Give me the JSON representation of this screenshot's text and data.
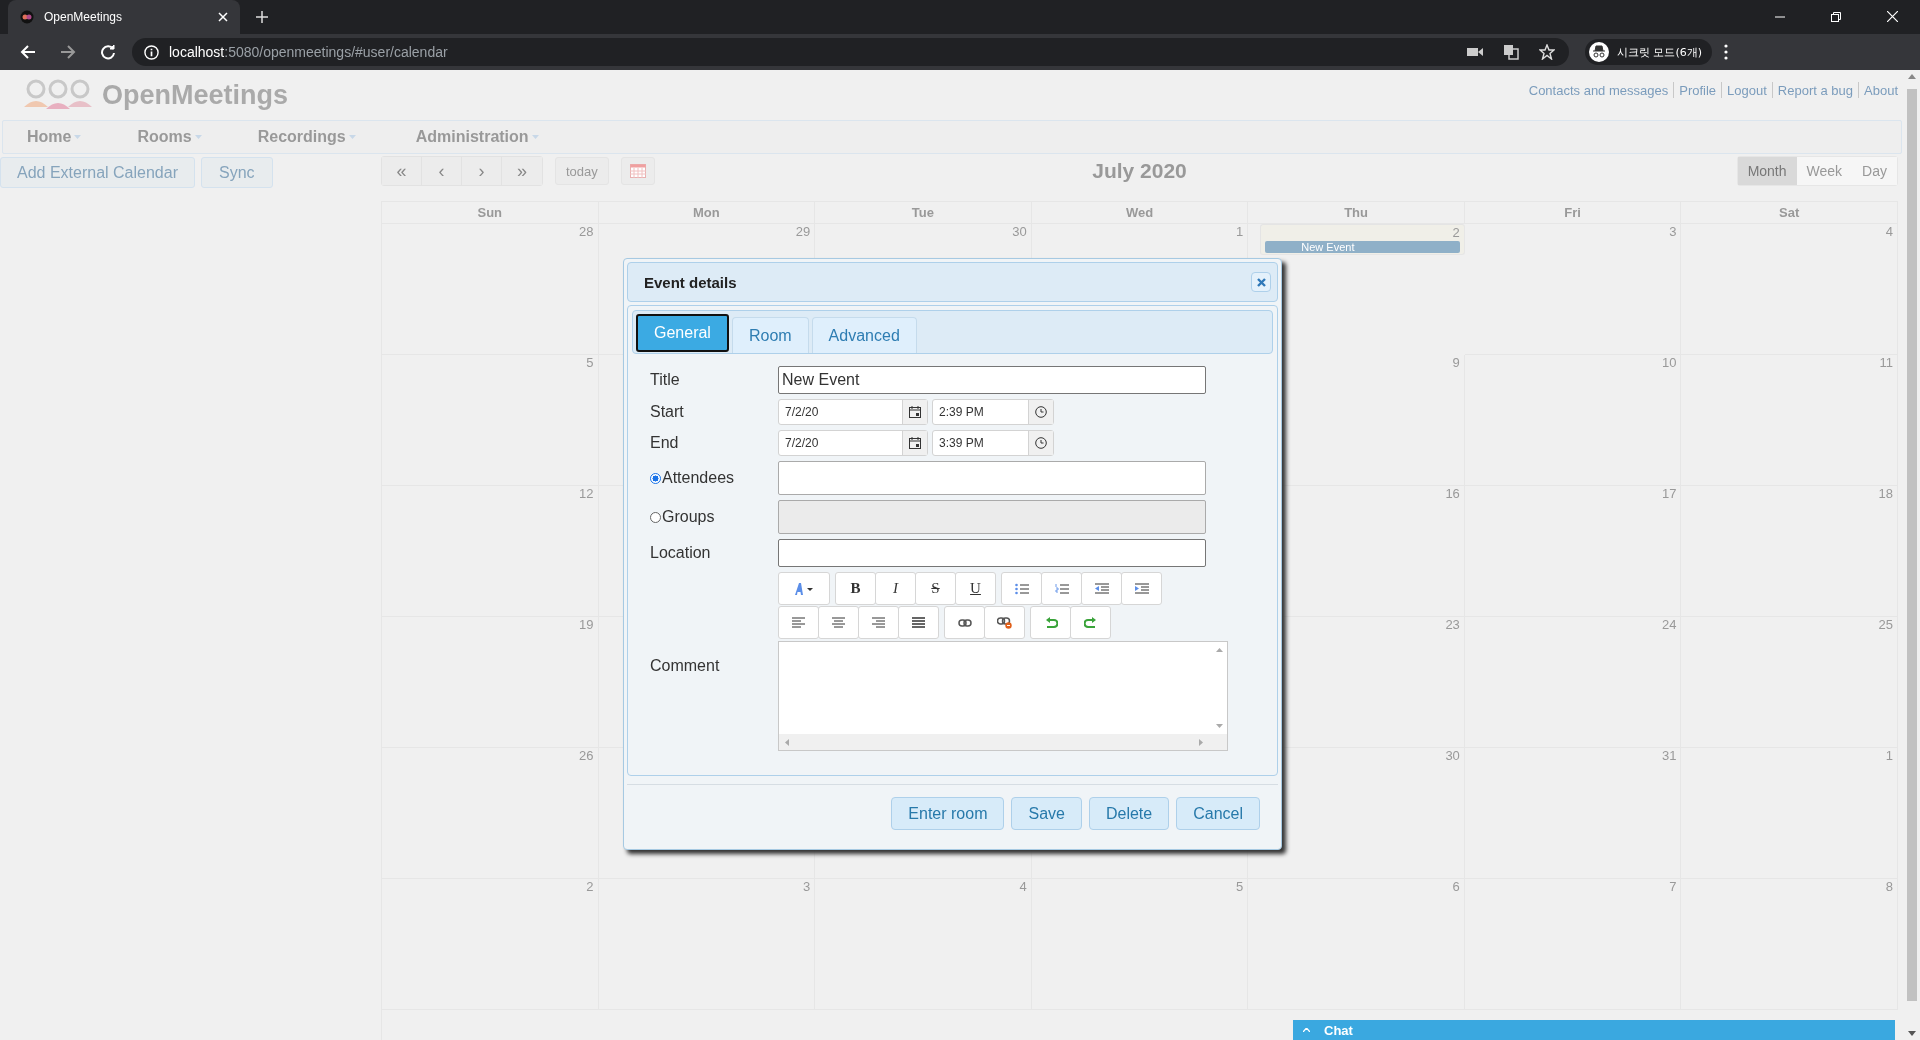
{
  "browser": {
    "tab_title": "OpenMeetings",
    "url_host": "localhost",
    "url_path": ":5080/openmeetings/#user/calendar",
    "profile_label": "시크릿 모드(6개)"
  },
  "app": {
    "logo_text": "OpenMeetings",
    "top_links": [
      "Contacts and messages",
      "Profile",
      "Logout",
      "Report a bug",
      "About"
    ],
    "menu": [
      "Home",
      "Rooms",
      "Recordings",
      "Administration"
    ],
    "side_buttons": [
      "Add External Calendar",
      "Sync"
    ],
    "nav_buttons": [
      "«",
      "‹",
      "›",
      "»"
    ],
    "today_label": "today",
    "month_title": "July 2020",
    "views": [
      {
        "label": "Month",
        "selected": true
      },
      {
        "label": "Week",
        "selected": false
      },
      {
        "label": "Day",
        "selected": false
      }
    ]
  },
  "calendar": {
    "weekdays": [
      "Sun",
      "Mon",
      "Tue",
      "Wed",
      "Thu",
      "Fri",
      "Sat"
    ],
    "weeks": [
      [
        {
          "kind": "day",
          "day": "28",
          "today": false
        },
        {
          "kind": "day",
          "day": "29",
          "today": false
        },
        {
          "kind": "day",
          "day": "30",
          "today": false
        },
        {
          "kind": "day",
          "day": "1",
          "today": false
        },
        {
          "kind": "day",
          "day": "2",
          "today": true,
          "events": [
            {
              "title": "New Event"
            }
          ]
        },
        {
          "kind": "day",
          "day": "3",
          "today": false
        },
        {
          "kind": "day",
          "day": "4",
          "today": false
        }
      ],
      [
        {
          "kind": "day",
          "day": "5",
          "today": false
        },
        {
          "kind": "day",
          "today": false
        },
        {
          "kind": "covered"
        },
        {
          "kind": "covered"
        },
        {
          "kind": "day",
          "day": "9",
          "today": false
        },
        {
          "kind": "day",
          "day": "10",
          "today": false
        },
        {
          "kind": "day",
          "day": "11",
          "today": false
        }
      ],
      [
        {
          "kind": "day",
          "day": "12",
          "today": false
        },
        {
          "kind": "day",
          "today": false
        },
        {
          "kind": "covered"
        },
        {
          "kind": "covered"
        },
        {
          "kind": "day",
          "day": "16",
          "today": false
        },
        {
          "kind": "day",
          "day": "17",
          "today": false
        },
        {
          "kind": "day",
          "day": "18",
          "today": false
        }
      ],
      [
        {
          "kind": "day",
          "day": "19",
          "today": false
        },
        {
          "kind": "day",
          "today": false
        },
        {
          "kind": "covered"
        },
        {
          "kind": "covered"
        },
        {
          "kind": "day",
          "day": "23",
          "today": false
        },
        {
          "kind": "day",
          "day": "24",
          "today": false
        },
        {
          "kind": "day",
          "day": "25",
          "today": false
        }
      ],
      [
        {
          "kind": "day",
          "day": "26",
          "today": false
        },
        {
          "kind": "day",
          "today": false
        },
        {
          "kind": "day",
          "today": false
        },
        {
          "kind": "day",
          "today": false
        },
        {
          "kind": "day",
          "day": "30",
          "today": false
        },
        {
          "kind": "day",
          "day": "31",
          "today": false
        },
        {
          "kind": "day",
          "day": "1",
          "today": false
        }
      ],
      [
        {
          "kind": "day",
          "day": "2",
          "today": false
        },
        {
          "kind": "day",
          "day": "3",
          "today": false
        },
        {
          "kind": "day",
          "day": "4",
          "today": false
        },
        {
          "kind": "day",
          "day": "5",
          "today": false
        },
        {
          "kind": "day",
          "day": "6",
          "today": false
        },
        {
          "kind": "day",
          "day": "7",
          "today": false
        },
        {
          "kind": "day",
          "day": "8",
          "today": false
        }
      ]
    ]
  },
  "dialog": {
    "title": "Event details",
    "tabs": [
      {
        "label": "General",
        "selected": true
      },
      {
        "label": "Room",
        "selected": false
      },
      {
        "label": "Advanced",
        "selected": false
      }
    ],
    "title_label": "Title",
    "title_value": "New Event",
    "start_label": "Start",
    "start_date": "7/2/20",
    "start_time": "2:39 PM",
    "end_label": "End",
    "end_date": "7/2/20",
    "end_time": "3:39 PM",
    "attendees": {
      "label": "Attendees",
      "selected": true
    },
    "groups": {
      "label": "Groups",
      "selected": false,
      "disabled": true
    },
    "location_label": "Location",
    "comment_label": "Comment",
    "format_buttons": [
      "B",
      "I",
      "S",
      "U"
    ],
    "buttons": [
      "Enter room",
      "Save",
      "Delete",
      "Cancel"
    ]
  },
  "chat": {
    "label": "Chat"
  }
}
